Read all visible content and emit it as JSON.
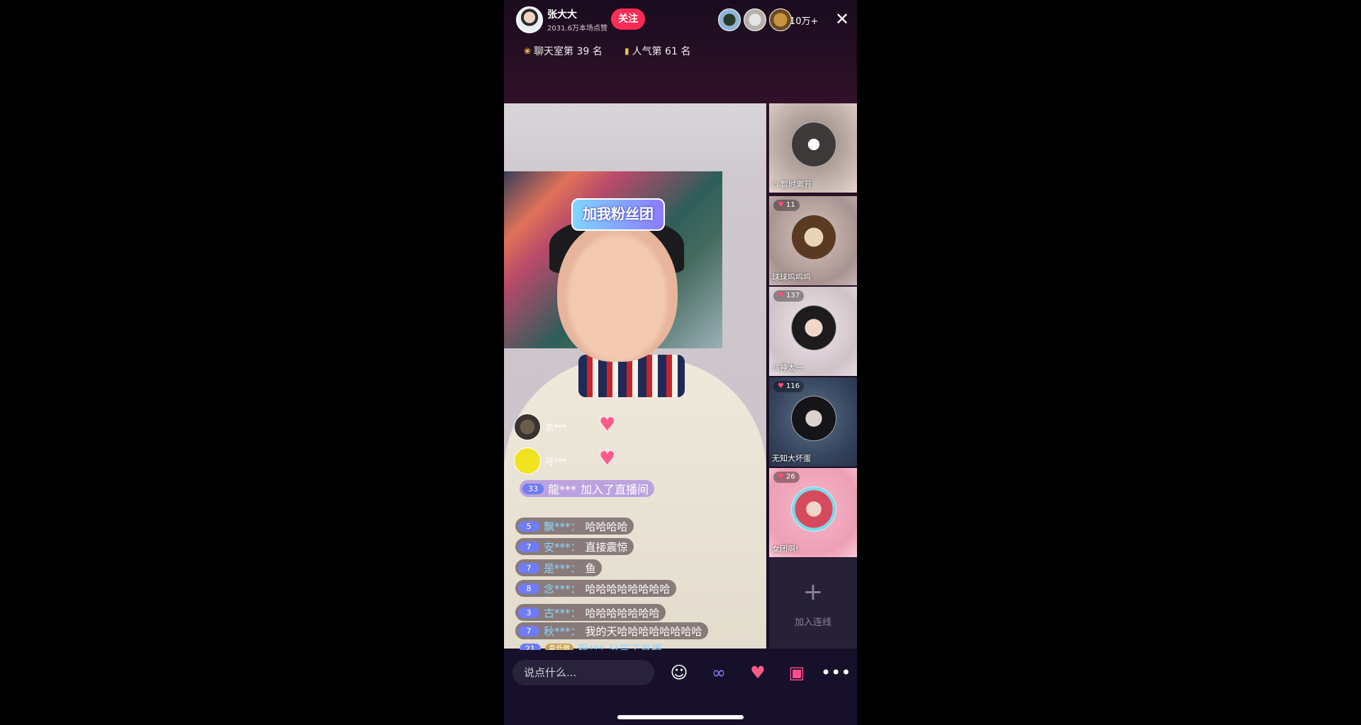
{
  "header": {
    "host_name": "张大大",
    "host_likes": "2031.6万本场点赞",
    "follow_label": "关注",
    "viewer_count": "10万+",
    "close_icon": "✕",
    "ranks": [
      {
        "icon": "chat-rank-icon",
        "label": "聊天室第 39 名"
      },
      {
        "icon": "popularity-icon",
        "label": "人气第 61 名"
      }
    ]
  },
  "video": {
    "sticker_text": "加我粉丝团"
  },
  "gifts": [
    {
      "name": "怎***"
    },
    {
      "name": "可***"
    }
  ],
  "join": {
    "level": "33",
    "user": "龍***",
    "text": "加入了直播间"
  },
  "chat": [
    {
      "level": "5",
      "user": "飘***：",
      "msg": "哈哈哈哈"
    },
    {
      "level": "7",
      "user": "安***：",
      "msg": "直接震惊"
    },
    {
      "level": "7",
      "user": "是***：",
      "msg": "鱼"
    },
    {
      "level": "8",
      "user": "念***：",
      "msg": "哈哈哈哈哈哈哈哈"
    },
    {
      "level": "3",
      "user": "古***：",
      "msg": "哈哈哈哈哈哈哈"
    },
    {
      "level": "7",
      "user": "秋***：",
      "msg": "我的天哈哈哈哈哈哈哈哈"
    }
  ],
  "share": {
    "level": "21",
    "badge": "真低微",
    "user": "程***",
    "text": "分享了直播"
  },
  "guests": [
    {
      "name": "暂时离开",
      "count": ""
    },
    {
      "name": "球球呜呜呜",
      "count": "11"
    },
    {
      "name": "八神太一",
      "count": "137"
    },
    {
      "name": "无知大坏蛋",
      "count": "116"
    },
    {
      "name": "女团啊!",
      "count": "26"
    }
  ],
  "add_link": {
    "plus": "+",
    "label": "加入连线"
  },
  "bottom": {
    "input_placeholder": "说点什么...",
    "icons": [
      "emoji-icon",
      "link-icon",
      "heart-icon",
      "gift-icon",
      "more-icon"
    ]
  },
  "colors": {
    "follow": "#fe2c55",
    "username": "#8fd6ff",
    "level_badge": "#6f7cf5"
  }
}
